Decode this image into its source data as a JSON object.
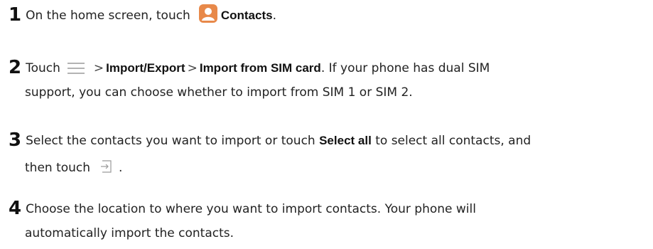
{
  "steps": [
    {
      "number": "1",
      "prefix": "On the home screen, touch",
      "icon": "contacts-app-icon",
      "bold": "Contacts",
      "suffix": "."
    },
    {
      "number": "2",
      "prefix": "Touch",
      "icon": "menu-icon",
      "sep1": ">",
      "bold1": "Import/Export",
      "sep2": ">",
      "bold2": "Import from SIM card",
      "suffix": ". If your phone has dual SIM",
      "line2": "support, you can choose whether to import from SIM 1 or SIM 2."
    },
    {
      "number": "3",
      "prefix": "Select the contacts you want to import or touch",
      "bold": "Select all",
      "suffix": "to select all contacts, and",
      "line2_prefix": "then touch",
      "icon": "import-icon",
      "line2_suffix": "."
    },
    {
      "number": "4",
      "line1": "Choose the location to where you want to import contacts. Your phone will",
      "line2": "automatically import the contacts."
    }
  ],
  "colors": {
    "contacts_icon_bg": "#e8894a",
    "icon_stroke": "#9a9a9a"
  }
}
